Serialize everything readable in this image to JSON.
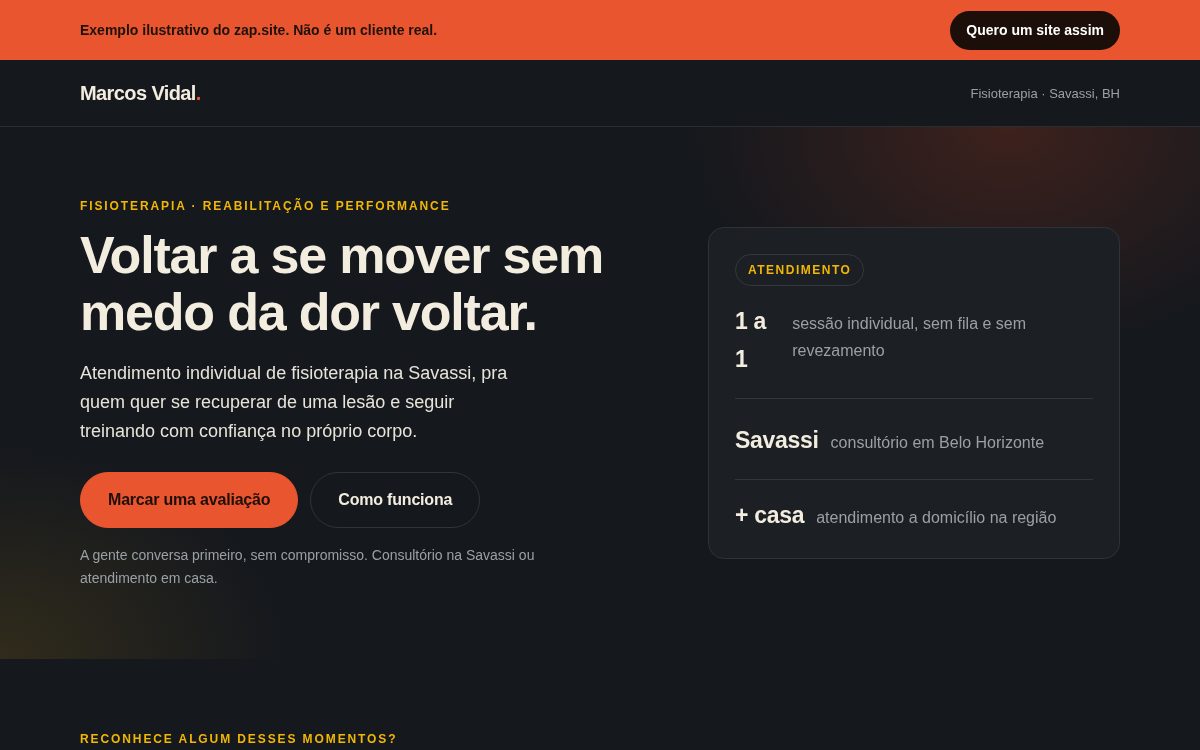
{
  "demo_banner": {
    "text": "Exemplo ilustrativo do zap.site. Não é um cliente real.",
    "button": "Quero um site assim"
  },
  "header": {
    "logo": "Marcos Vidal",
    "logo_accent": ".",
    "tagline": "Fisioterapia · Savassi, BH"
  },
  "hero": {
    "eyebrow": "FISIOTERAPIA · REABILITAÇÃO E PERFORMANCE",
    "title": "Voltar a se mover sem medo da dor voltar.",
    "description": "Atendimento individual de fisioterapia na Savassi, pra quem quer se recuperar de uma lesão e seguir treinando com confiança no próprio corpo.",
    "buttons": [
      {
        "label": "Marcar uma avaliação",
        "kind": "primary"
      },
      {
        "label": "Como funciona",
        "kind": "secondary"
      }
    ],
    "note": "A gente conversa primeiro, sem compromisso. Consultório na Savassi ou atendimento em casa."
  },
  "info_card": {
    "badge": "ATENDIMENTO",
    "items": [
      {
        "term": "1 a 1",
        "description": "sessão individual, sem fila e sem revezamento"
      },
      {
        "term": "Savassi",
        "description": "consultório em Belo Horizonte"
      },
      {
        "term": "+ casa",
        "description": "atendimento a domicílio na região"
      }
    ]
  },
  "next_section": {
    "eyebrow": "RECONHECE ALGUM DESSES MOMENTOS?"
  }
}
